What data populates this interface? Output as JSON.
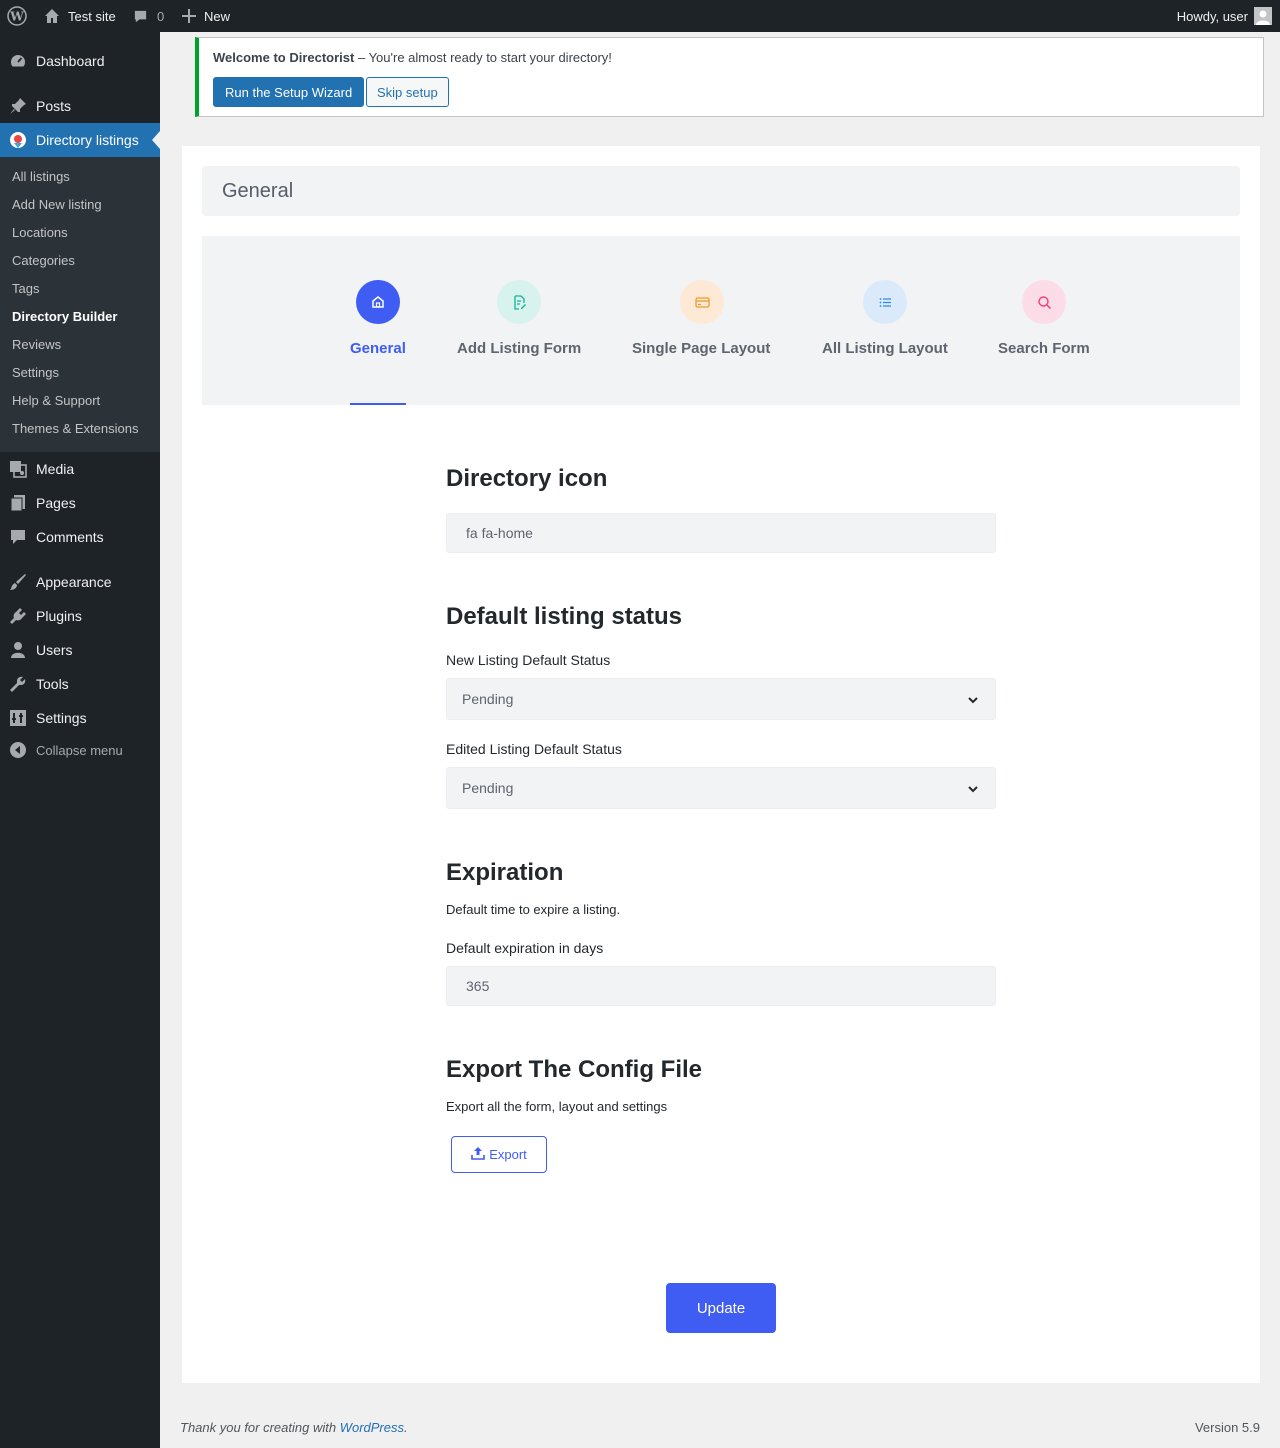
{
  "admin_bar": {
    "site_name": "Test site",
    "comments_count": "0",
    "new_label": "New",
    "howdy": "Howdy, user"
  },
  "sidebar": {
    "items": [
      {
        "label": "Dashboard",
        "icon": "dashboard-icon"
      },
      {
        "label": "Posts",
        "icon": "pin-icon"
      },
      {
        "label": "Directory listings",
        "icon": "directorist-icon"
      },
      {
        "label": "Media",
        "icon": "media-icon"
      },
      {
        "label": "Pages",
        "icon": "pages-icon"
      },
      {
        "label": "Comments",
        "icon": "comment-icon"
      },
      {
        "label": "Appearance",
        "icon": "paintbrush-icon"
      },
      {
        "label": "Plugins",
        "icon": "plugin-icon"
      },
      {
        "label": "Users",
        "icon": "user-icon"
      },
      {
        "label": "Tools",
        "icon": "wrench-icon"
      },
      {
        "label": "Settings",
        "icon": "settings-icon"
      },
      {
        "label": "Collapse menu",
        "icon": "collapse-icon"
      }
    ],
    "submenu": [
      "All listings",
      "Add New listing",
      "Locations",
      "Categories",
      "Tags",
      "Directory Builder",
      "Reviews",
      "Settings",
      "Help & Support",
      "Themes & Extensions"
    ]
  },
  "notice": {
    "title": "Welcome to Directorist",
    "text": " – You're almost ready to start your directory!",
    "primary_button": "Run the Setup Wizard",
    "secondary_button": "Skip setup"
  },
  "page": {
    "header": "General",
    "tabs": [
      {
        "label": "General",
        "icon": "home-icon",
        "color": "#3f5cf3",
        "bg": "#3f5cf3"
      },
      {
        "label": "Add Listing Form",
        "icon": "file-edit-icon",
        "color": "#14b39a",
        "bg": "#d8f2ee"
      },
      {
        "label": "Single Page Layout",
        "icon": "credit-card-icon",
        "color": "#f09a2a",
        "bg": "#fde9d6"
      },
      {
        "label": "All Listing Layout",
        "icon": "list-icon",
        "color": "#2c8be8",
        "bg": "#dbeafa"
      },
      {
        "label": "Search Form",
        "icon": "search-icon",
        "color": "#ef3f7a",
        "bg": "#fbdce7"
      }
    ]
  },
  "form": {
    "directory_icon": {
      "title": "Directory icon",
      "value": "fa fa-home"
    },
    "default_status": {
      "title": "Default listing status",
      "new_label": "New Listing Default Status",
      "new_value": "Pending",
      "edited_label": "Edited Listing Default Status",
      "edited_value": "Pending"
    },
    "expiration": {
      "title": "Expiration",
      "desc": "Default time to expire a listing.",
      "label": "Default expiration in days",
      "value": "365"
    },
    "export": {
      "title": "Export The Config File",
      "desc": "Export all the form, layout and settings",
      "button": "Export"
    },
    "update_button": "Update"
  },
  "footer": {
    "thanks_prefix": "Thank you for creating with ",
    "thanks_link": "WordPress",
    "thanks_suffix": ".",
    "version": "Version 5.9"
  }
}
